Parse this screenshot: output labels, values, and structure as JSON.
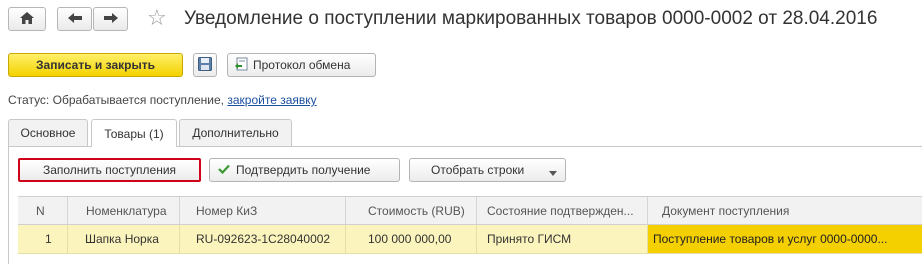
{
  "header": {
    "title": "Уведомление о поступлении маркированных товаров 0000-0002 от 28.04.2016"
  },
  "toolbar": {
    "save_close_label": "Записать и закрыть",
    "exchange_protocol_label": "Протокол обмена"
  },
  "status": {
    "label": "Статус:",
    "text": "Обрабатывается поступление,",
    "link": "закройте заявку"
  },
  "tabs": [
    {
      "label": "Основное",
      "active": false
    },
    {
      "label": "Товары (1)",
      "active": true
    },
    {
      "label": "Дополнительно",
      "active": false
    }
  ],
  "goods_toolbar": {
    "fill_label": "Заполнить поступления",
    "confirm_label": "Подтвердить получение",
    "select_rows_label": "Отобрать строки"
  },
  "table": {
    "columns": [
      "N",
      "Номенклатура",
      "Номер КиЗ",
      "Стоимость (RUB)",
      "Состояние подтвержден...",
      "Документ поступления"
    ],
    "rows": [
      [
        "1",
        "Шапка Норка",
        "RU-092623-1C28040002",
        "100 000 000,00",
        "Принято ГИСМ",
        "Поступление товаров и услуг 0000-0000..."
      ]
    ]
  },
  "colors": {
    "primary_button": "#f3d200",
    "selected_row": "#fbf5bd",
    "selected_cell": "#f5d000",
    "highlight_border": "#d0021b",
    "link": "#1c4fa0",
    "confirm_check": "#3a9a2f"
  }
}
